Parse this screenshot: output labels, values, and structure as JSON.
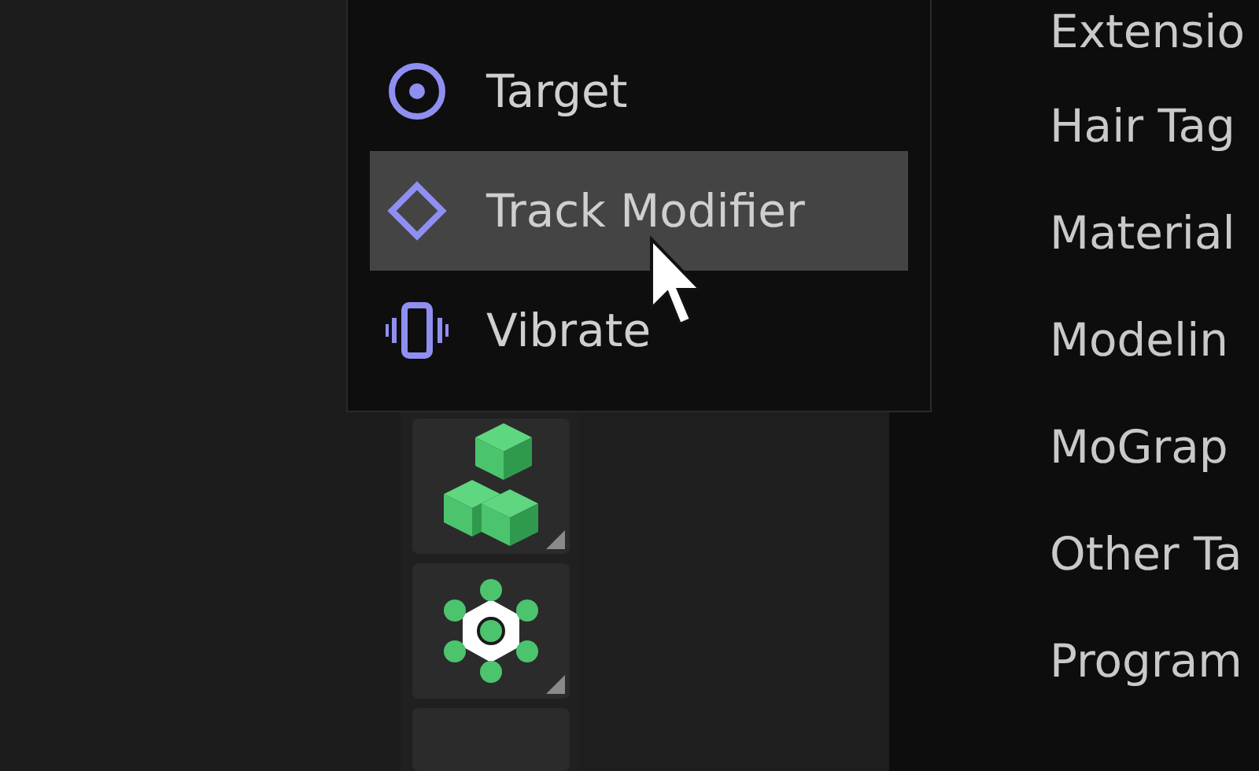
{
  "menu": {
    "items": [
      {
        "label": "Target",
        "kind": "target",
        "selected": false
      },
      {
        "label": "Track Modifier",
        "kind": "diamond",
        "selected": true
      },
      {
        "label": "Vibrate",
        "kind": "vibrate",
        "selected": false
      }
    ]
  },
  "toolbar": {
    "buttons": [
      {
        "kind": "cubes"
      },
      {
        "kind": "gear"
      },
      {
        "kind": "blank"
      }
    ]
  },
  "panel": {
    "items": [
      "Extensio",
      "Hair Tag",
      "Material",
      "Modelin",
      "MoGrap",
      "Other Ta",
      "Program"
    ]
  }
}
